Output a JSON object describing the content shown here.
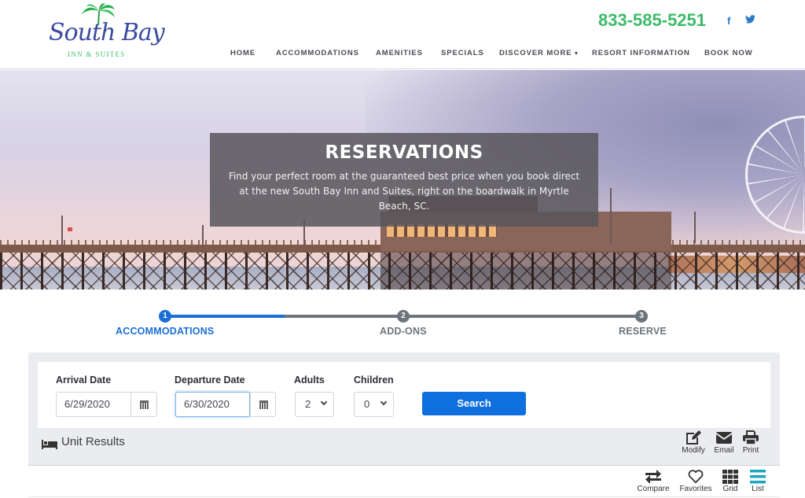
{
  "header": {
    "logo": {
      "name": "South Bay",
      "sub": "INN & SUITES"
    },
    "phone": "833-585-5251",
    "social": [
      {
        "icon": "facebook-icon",
        "glyph": "f"
      },
      {
        "icon": "twitter-icon",
        "glyph": "🐦"
      }
    ],
    "nav": [
      {
        "label": "HOME"
      },
      {
        "label": "ACCOMMODATIONS"
      },
      {
        "label": "AMENITIES"
      },
      {
        "label": "SPECIALS"
      },
      {
        "label": "DISCOVER MORE",
        "dropdown": true
      },
      {
        "label": "RESORT INFORMATION"
      },
      {
        "label": "BOOK NOW"
      }
    ]
  },
  "hero": {
    "title": "RESERVATIONS",
    "text": "Find your perfect room at the guaranteed best price when you book direct at the new South Bay Inn and Suites, right on the boardwalk in Myrtle Beach, SC."
  },
  "stepper": {
    "steps": [
      {
        "number": "1",
        "label": "ACCOMMODATIONS",
        "state": "active"
      },
      {
        "number": "2",
        "label": "ADD-ONS",
        "state": "pending"
      },
      {
        "number": "3",
        "label": "RESERVE",
        "state": "pending"
      }
    ],
    "colors": {
      "active": "#1a6fd6",
      "pending": "#6d747b"
    }
  },
  "search": {
    "arrival_label": "Arrival Date",
    "arrival_value": "6/29/2020",
    "departure_label": "Departure Date",
    "departure_value": "6/30/2020",
    "adults_label": "Adults",
    "adults_value": "2",
    "children_label": "Children",
    "children_value": "0",
    "search_button": "Search"
  },
  "results": {
    "title": "Unit Results",
    "actions": [
      {
        "label": "Modify"
      },
      {
        "label": "Email"
      },
      {
        "label": "Print"
      }
    ],
    "view_options": [
      {
        "label": "Compare"
      },
      {
        "label": "Favorites"
      },
      {
        "label": "Grid"
      },
      {
        "label": "List",
        "active": true
      }
    ],
    "active_color": "#19a7bf"
  }
}
